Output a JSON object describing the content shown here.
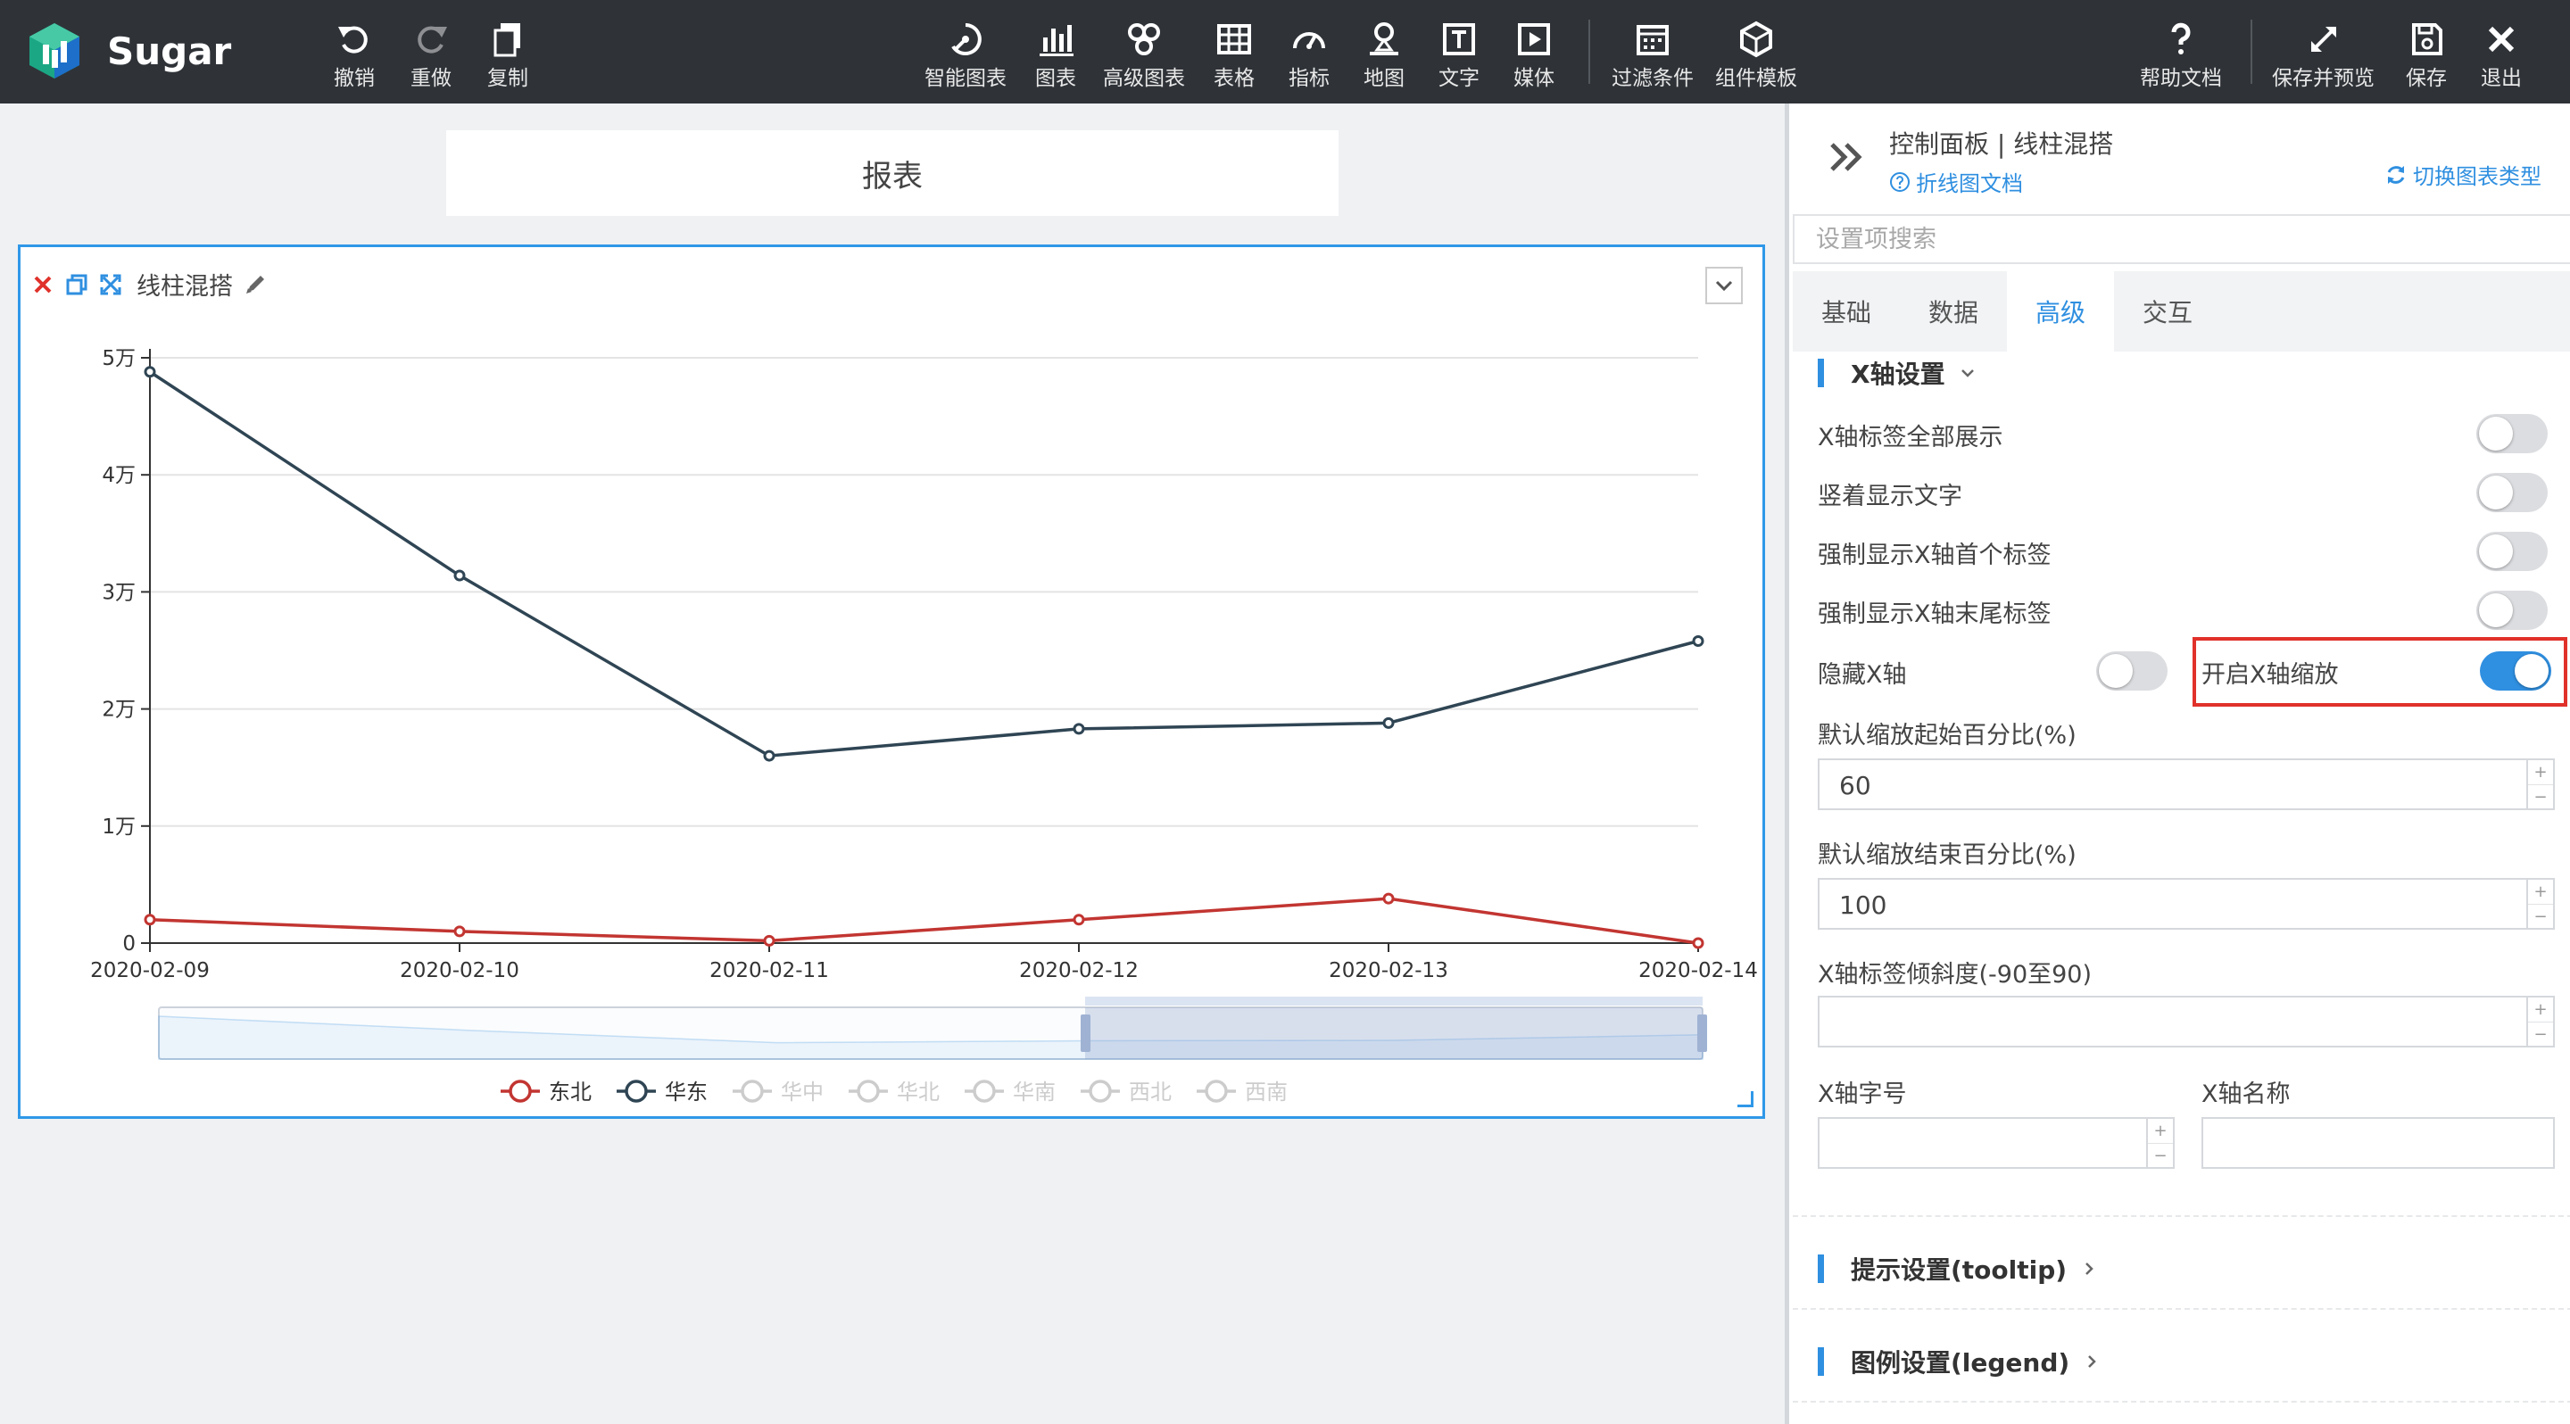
{
  "app": {
    "brand": "Sugar"
  },
  "toolbar": {
    "left": [
      {
        "label": "撤销",
        "icon": "undo-icon"
      },
      {
        "label": "重做",
        "icon": "redo-icon"
      },
      {
        "label": "复制",
        "icon": "copy-icon"
      }
    ],
    "center": [
      {
        "label": "智能图表",
        "icon": "smart-chart-icon"
      },
      {
        "label": "图表",
        "icon": "bar-chart-icon"
      },
      {
        "label": "高级图表",
        "icon": "advanced-chart-icon"
      },
      {
        "label": "表格",
        "icon": "table-icon"
      },
      {
        "label": "指标",
        "icon": "gauge-icon"
      },
      {
        "label": "地图",
        "icon": "map-icon"
      },
      {
        "label": "文字",
        "icon": "text-icon"
      },
      {
        "label": "媒体",
        "icon": "media-icon"
      },
      {
        "label": "过滤条件",
        "icon": "filter-calendar-icon"
      },
      {
        "label": "组件模板",
        "icon": "template-icon"
      }
    ],
    "right": [
      {
        "label": "帮助文档",
        "icon": "help-icon"
      },
      {
        "label": "保存并预览",
        "icon": "expand-icon"
      },
      {
        "label": "保存",
        "icon": "save-icon"
      },
      {
        "label": "退出",
        "icon": "close-icon"
      }
    ]
  },
  "report": {
    "title": "报表"
  },
  "widget": {
    "title": "线柱混搭"
  },
  "chart_data": {
    "type": "line",
    "x": [
      "2020-02-09",
      "2020-02-10",
      "2020-02-11",
      "2020-02-12",
      "2020-02-13",
      "2020-02-14"
    ],
    "yticks": [
      "0",
      "1万",
      "2万",
      "3万",
      "4万",
      "5万"
    ],
    "ylim": [
      0,
      50000
    ],
    "grid": true,
    "legend_position": "bottom",
    "series": [
      {
        "name": "东北",
        "color": "#c23531",
        "values": [
          2000,
          1000,
          200,
          2000,
          3800,
          0
        ],
        "active": true
      },
      {
        "name": "华东",
        "color": "#2f4554",
        "values": [
          48800,
          31400,
          16000,
          18300,
          18800,
          25800
        ],
        "active": true
      },
      {
        "name": "华中",
        "color": "#cccccc",
        "values": [],
        "active": false
      },
      {
        "name": "华北",
        "color": "#cccccc",
        "values": [],
        "active": false
      },
      {
        "name": "华南",
        "color": "#cccccc",
        "values": [],
        "active": false
      },
      {
        "name": "西北",
        "color": "#cccccc",
        "values": [],
        "active": false
      },
      {
        "name": "西南",
        "color": "#cccccc",
        "values": [],
        "active": false
      }
    ],
    "datazoom": {
      "start_percent": 60,
      "end_percent": 100
    }
  },
  "panel": {
    "title": "控制面板 | 线柱混搭",
    "doc_link": "折线图文档",
    "switch_type": "切换图表类型",
    "search_placeholder": "设置项搜索",
    "tabs": [
      "基础",
      "数据",
      "高级",
      "交互"
    ],
    "active_tab": "高级",
    "xaxis_section": "X轴设置",
    "options": [
      {
        "label": "X轴标签全部展示",
        "on": false
      },
      {
        "label": "竖着显示文字",
        "on": false
      },
      {
        "label": "强制显示X轴首个标签",
        "on": false
      },
      {
        "label": "强制显示X轴末尾标签",
        "on": false
      },
      {
        "label": "隐藏X轴",
        "on": false
      },
      {
        "label": "开启X轴缩放",
        "on": true
      }
    ],
    "zoom_start_label": "默认缩放起始百分比(%)",
    "zoom_start_value": "60",
    "zoom_end_label": "默认缩放结束百分比(%)",
    "zoom_end_value": "100",
    "label_tilt_label": "X轴标签倾斜度(-90至90)",
    "font_size_label": "X轴字号",
    "axis_name_label": "X轴名称",
    "tooltip_section": "提示设置(tooltip)",
    "legend_section": "图例设置(legend)"
  }
}
